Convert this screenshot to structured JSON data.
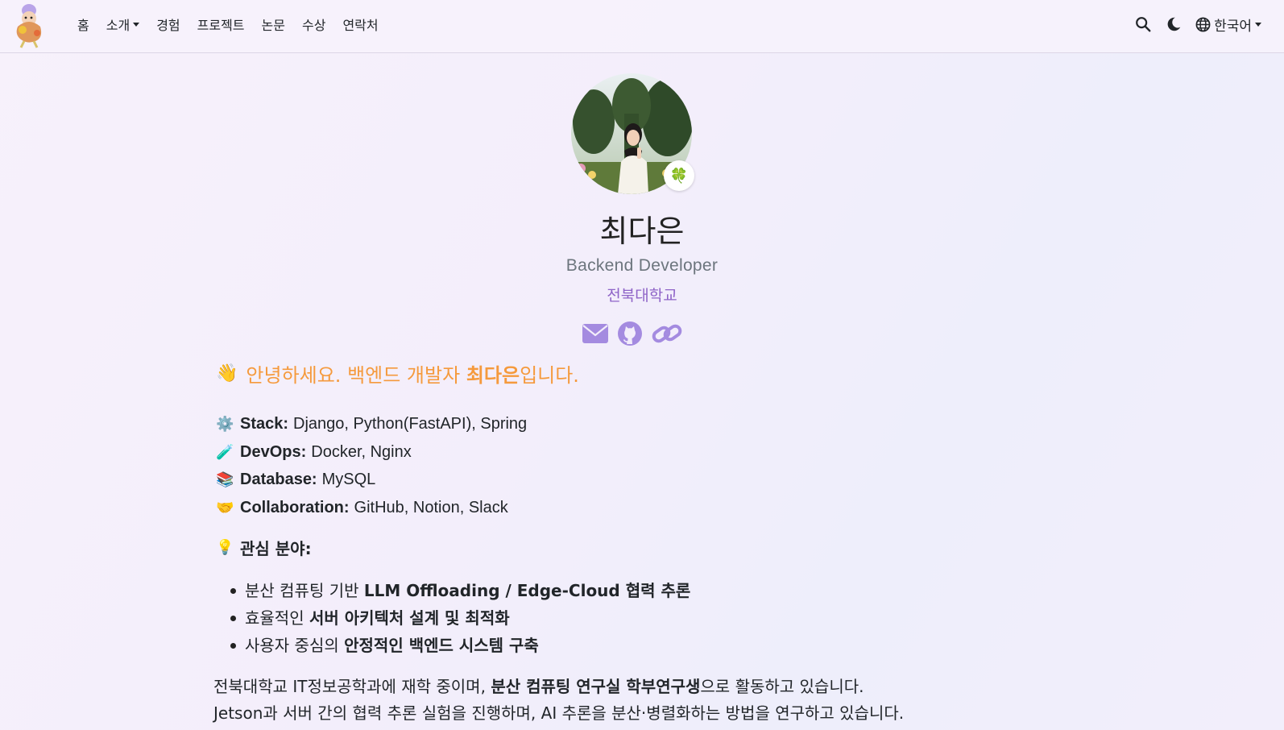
{
  "nav": {
    "items": [
      {
        "label": "홈"
      },
      {
        "label": "소개",
        "dropdown": true
      },
      {
        "label": "경험"
      },
      {
        "label": "프로젝트"
      },
      {
        "label": "논문"
      },
      {
        "label": "수상"
      },
      {
        "label": "연락처"
      }
    ],
    "language": "한국어"
  },
  "profile": {
    "badge_emoji": "🍀",
    "name": "최다은",
    "role": "Backend Developer",
    "school": "전북대학교",
    "socials": [
      "envelope-icon",
      "github-icon",
      "link-icon"
    ]
  },
  "intro": {
    "wave": "👋",
    "greeting_prefix": "안녕하세요. 백엔드 개발자 ",
    "greeting_name": "최다은",
    "greeting_suffix": "입니다."
  },
  "tech": [
    {
      "emoji": "⚙️",
      "label": "Stack:",
      "value": "Django, Python(FastAPI), Spring"
    },
    {
      "emoji": "🧪",
      "label": "DevOps:",
      "value": "Docker, Nginx"
    },
    {
      "emoji": "📚",
      "label": "Database:",
      "value": "MySQL"
    },
    {
      "emoji": "🤝",
      "label": "Collaboration:",
      "value": "GitHub, Notion, Slack"
    }
  ],
  "interests": {
    "emoji": "💡",
    "title": "관심 분야:",
    "items": [
      {
        "pre": "분산 컴퓨팅 기반 ",
        "bold": "LLM Offloading / Edge-Cloud 협력 추론",
        "post": ""
      },
      {
        "pre": "효율적인 ",
        "bold": "서버 아키텍처 설계 및 최적화",
        "post": ""
      },
      {
        "pre": "사용자 중심의 ",
        "bold": "안정적인 백엔드 시스템 구축",
        "post": ""
      }
    ]
  },
  "about": {
    "line1_pre": "전북대학교 IT정보공학과에 재학 중이며, ",
    "line1_bold": "분산 컴퓨팅 연구실 학부연구생",
    "line1_post": "으로 활동하고 있습니다.",
    "line2": "Jetson과 서버 간의 협력 추론 실험을 진행하며, AI 추론을 분산·병렬화하는 방법을 연구하고 있습니다."
  },
  "colors": {
    "accent": "#a48be0",
    "greeting": "#f59a3d",
    "school": "#8e63c7"
  }
}
